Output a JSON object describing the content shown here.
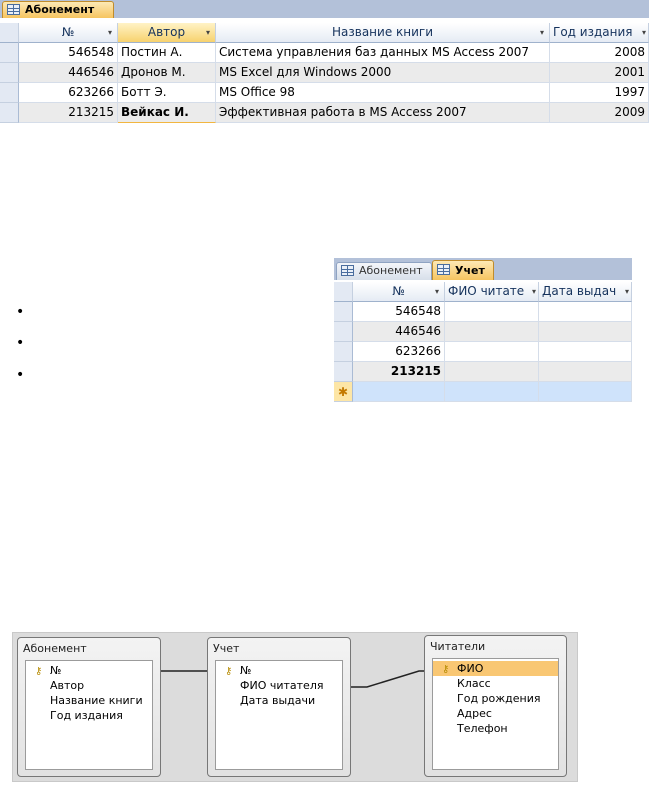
{
  "datasheet1": {
    "tab_label": "Абонемент",
    "columns": [
      {
        "label": "№",
        "dropdown": "▾"
      },
      {
        "label": "Автор",
        "dropdown": "▾"
      },
      {
        "label": "Название книги",
        "dropdown": "▾"
      },
      {
        "label": "Год издания",
        "dropdown": "▾"
      }
    ],
    "rows": [
      {
        "num": "546548",
        "author": "Постин А.",
        "title": "Система управления баз данных MS Access 2007",
        "year": "2008"
      },
      {
        "num": "446546",
        "author": "Дронов М.",
        "title": "MS Excel для Windows 2000",
        "year": "2001"
      },
      {
        "num": "623266",
        "author": "Ботт Э.",
        "title": "MS Office 98",
        "year": "1997"
      },
      {
        "num": "213215",
        "author": "Вейкас И.",
        "title": "Эффективная работа в MS Access 2007",
        "year": "2009"
      }
    ]
  },
  "bullets": [
    "•",
    "•",
    "•"
  ],
  "datasheet2": {
    "tabs": [
      "Абонемент",
      "Учет"
    ],
    "columns": [
      {
        "label": "№",
        "dropdown": "▾"
      },
      {
        "label": "ФИО читате",
        "dropdown": "▾"
      },
      {
        "label": "Дата выдач",
        "dropdown": "▾"
      }
    ],
    "rows": [
      {
        "num": "546548"
      },
      {
        "num": "446546"
      },
      {
        "num": "623266"
      },
      {
        "num": "213215"
      }
    ],
    "new_row_marker": "✱"
  },
  "diagram": {
    "tables": [
      {
        "title": "Абонемент",
        "fields": [
          "№",
          "Автор",
          "Название книги",
          "Год издания"
        ]
      },
      {
        "title": "Учет",
        "fields": [
          "№",
          "ФИО читателя",
          "Дата выдачи"
        ]
      },
      {
        "title": "Читатели",
        "fields": [
          "ФИО",
          "Класс",
          "Год рождения",
          "Адрес",
          "Телефон"
        ]
      }
    ],
    "key_icon": "⚷"
  },
  "colors": {
    "active_tab": "#f6c460",
    "selected_column": "#f7d26e",
    "new_row": "#cfe3fb",
    "highlight_field": "#f9c773"
  }
}
